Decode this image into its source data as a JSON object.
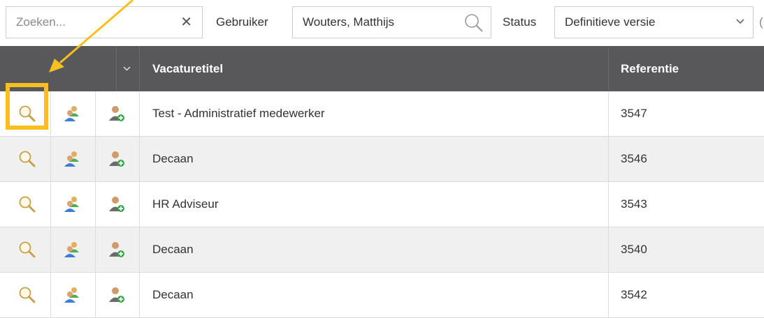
{
  "filters": {
    "search": {
      "placeholder": "Zoeken...",
      "value": ""
    },
    "user": {
      "label": "Gebruiker",
      "value": "Wouters, Matthijs"
    },
    "status": {
      "label": "Status",
      "selected": "Definitieve versie"
    }
  },
  "table": {
    "columns": {
      "title": "Vacaturetitel",
      "reference": "Referentie"
    },
    "rows": [
      {
        "title": "Test - Administratief medewerker",
        "reference": "3547"
      },
      {
        "title": "Decaan",
        "reference": "3546"
      },
      {
        "title": "HR Adviseur",
        "reference": "3543"
      },
      {
        "title": "Decaan",
        "reference": "3540"
      },
      {
        "title": "Decaan",
        "reference": "3542"
      }
    ]
  },
  "colors": {
    "header_bg": "#58585b",
    "highlight": "#f9bf1f",
    "row_alt": "#f0f0f0"
  },
  "icons": {
    "view": "magnifier-icon",
    "assign": "users-icon",
    "add_user": "user-add-icon"
  }
}
